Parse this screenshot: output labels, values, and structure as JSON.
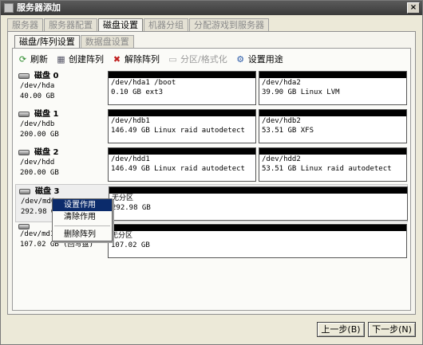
{
  "window": {
    "title": "服务器添加",
    "close_glyph": "×"
  },
  "tabs": [
    "服务器",
    "服务器配置",
    "磁盘设置",
    "机器分组",
    "分配游戏到服务器"
  ],
  "subtabs": [
    "磁盘/阵列设置",
    "数据盘设置"
  ],
  "toolbar": {
    "refresh": "刷新",
    "create_array": "创建阵列",
    "remove_array": "解除阵列",
    "format": "分区/格式化",
    "set_usage": "设置用途",
    "icons": [
      "refresh-icon",
      "create-array-icon",
      "remove-array-icon",
      "format-icon",
      "settings-icon"
    ]
  },
  "disks": [
    {
      "title": "磁盘 0",
      "dev": "/dev/hda",
      "size": "40.00 GB",
      "note": "",
      "parts": [
        {
          "l1": "/dev/hda1 /boot",
          "l2": "0.10 GB ext3"
        },
        {
          "l1": "/dev/hda2",
          "l2": "39.90 GB Linux LVM"
        }
      ]
    },
    {
      "title": "磁盘 1",
      "dev": "/dev/hdb",
      "size": "200.00 GB",
      "note": "",
      "parts": [
        {
          "l1": "/dev/hdb1",
          "l2": "146.49 GB Linux raid autodetect"
        },
        {
          "l1": "/dev/hdb2",
          "l2": "53.51 GB XFS"
        }
      ]
    },
    {
      "title": "磁盘 2",
      "dev": "/dev/hdd",
      "size": "200.00 GB",
      "note": "",
      "parts": [
        {
          "l1": "/dev/hdd1",
          "l2": "146.49 GB Linux raid autodetect"
        },
        {
          "l1": "/dev/hdd2",
          "l2": "53.51 GB Linux raid autodetect"
        }
      ]
    },
    {
      "title": "磁盘 3",
      "dev": "/dev/md0",
      "size": "292.98 G",
      "note": "",
      "parts": [
        {
          "l1": "无分区",
          "l2": "292.98 GB"
        }
      ]
    },
    {
      "title": "",
      "dev": "/dev/md1",
      "size": "107.02 GB",
      "note": "(回写盘)",
      "parts": [
        {
          "l1": "无分区",
          "l2": "107.02 GB"
        }
      ]
    }
  ],
  "context_menu": {
    "set_usage": "设置作用",
    "clear_usage": "清除作用",
    "delete_array": "删除阵列"
  },
  "buttons": {
    "prev": "上一步(B)",
    "next": "下一步(N)"
  }
}
